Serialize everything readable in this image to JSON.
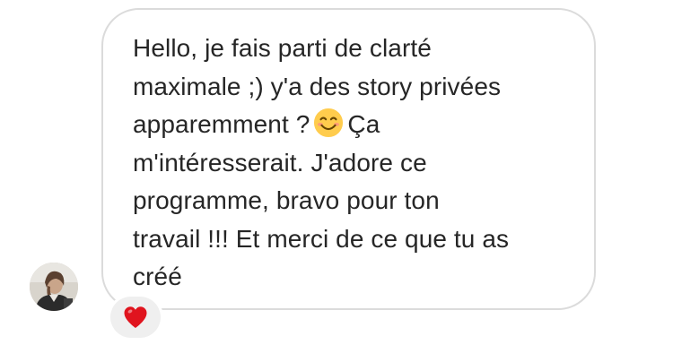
{
  "message": {
    "text_part1": "Hello, je fais parti de clarté\nmaximale ;) y'a des story privées\napparemment ?",
    "emoji": "smiling-face-with-smiling-eyes",
    "text_part2": "Ça\nm'intéresserait. J'adore ce\nprogramme, bravo pour ton\ntravail !!! Et merci de ce que tu as\ncréé"
  },
  "reaction": {
    "icon": "red-heart",
    "color": "#e0141e"
  },
  "colors": {
    "bubble_border": "#dbdbdb",
    "text": "#262626",
    "reaction_bg": "#efefef"
  }
}
